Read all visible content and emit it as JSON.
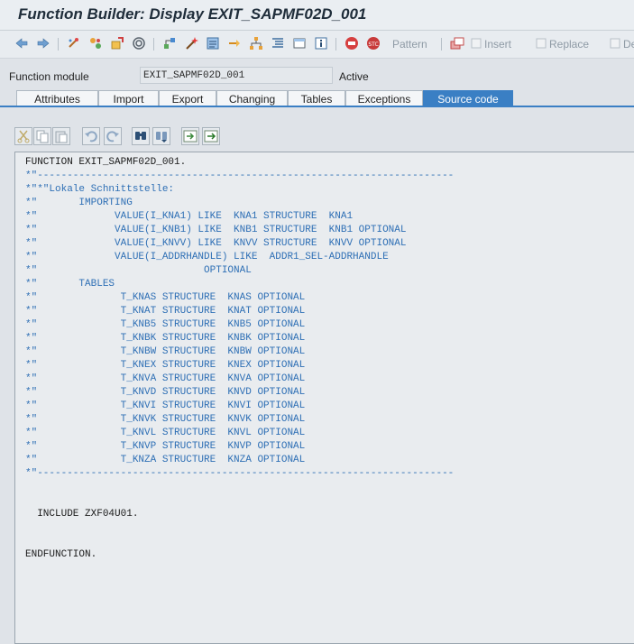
{
  "window": {
    "title": "Function Builder: Display EXIT_SAPMF02D_001"
  },
  "toolbar": {
    "icons": [
      "back-arrow-icon",
      "forward-arrow-icon",
      "other-object-icon",
      "display-change-icon",
      "activate-icon",
      "check-icon",
      "where-used-icon",
      "magic-wand-icon",
      "object-list-icon",
      "navigation-icon",
      "hierarchy-icon",
      "indent-icon",
      "window-icon",
      "info-icon",
      "test-icon",
      "stop-icon"
    ],
    "pattern_label": "Pattern",
    "insert_label": "Insert",
    "replace_label": "Replace",
    "delete_label": "De"
  },
  "function_module": {
    "label": "Function module",
    "value": "EXIT_SAPMF02D_001",
    "status": "Active"
  },
  "tabs": [
    {
      "label": "Attributes",
      "active": false
    },
    {
      "label": "Import",
      "active": false
    },
    {
      "label": "Export",
      "active": false
    },
    {
      "label": "Changing",
      "active": false
    },
    {
      "label": "Tables",
      "active": false
    },
    {
      "label": "Exceptions",
      "active": false
    },
    {
      "label": "Source code",
      "active": true
    }
  ],
  "editor_toolbar": {
    "icons": [
      "cut-icon",
      "copy-icon",
      "paste-icon",
      "undo-icon",
      "redo-icon",
      "find-icon",
      "find-next-icon",
      "insert-block-icon",
      "export-block-icon"
    ]
  },
  "source_code": [
    {
      "text": "FUNCTION EXIT_SAPMF02D_001.",
      "type": "k"
    },
    {
      "text": "*\"----------------------------------------------------------------------",
      "type": "c"
    },
    {
      "text": "*\"*\"Lokale Schnittstelle:",
      "type": "c"
    },
    {
      "text": "*\"       IMPORTING",
      "type": "c"
    },
    {
      "text": "*\"             VALUE(I_KNA1) LIKE  KNA1 STRUCTURE  KNA1",
      "type": "c"
    },
    {
      "text": "*\"             VALUE(I_KNB1) LIKE  KNB1 STRUCTURE  KNB1 OPTIONAL",
      "type": "c"
    },
    {
      "text": "*\"             VALUE(I_KNVV) LIKE  KNVV STRUCTURE  KNVV OPTIONAL",
      "type": "c"
    },
    {
      "text": "*\"             VALUE(I_ADDRHANDLE) LIKE  ADDR1_SEL-ADDRHANDLE",
      "type": "c"
    },
    {
      "text": "*\"                            OPTIONAL",
      "type": "c"
    },
    {
      "text": "*\"       TABLES",
      "type": "c"
    },
    {
      "text": "*\"              T_KNAS STRUCTURE  KNAS OPTIONAL",
      "type": "c"
    },
    {
      "text": "*\"              T_KNAT STRUCTURE  KNAT OPTIONAL",
      "type": "c"
    },
    {
      "text": "*\"              T_KNB5 STRUCTURE  KNB5 OPTIONAL",
      "type": "c"
    },
    {
      "text": "*\"              T_KNBK STRUCTURE  KNBK OPTIONAL",
      "type": "c"
    },
    {
      "text": "*\"              T_KNBW STRUCTURE  KNBW OPTIONAL",
      "type": "c"
    },
    {
      "text": "*\"              T_KNEX STRUCTURE  KNEX OPTIONAL",
      "type": "c"
    },
    {
      "text": "*\"              T_KNVA STRUCTURE  KNVA OPTIONAL",
      "type": "c"
    },
    {
      "text": "*\"              T_KNVD STRUCTURE  KNVD OPTIONAL",
      "type": "c"
    },
    {
      "text": "*\"              T_KNVI STRUCTURE  KNVI OPTIONAL",
      "type": "c"
    },
    {
      "text": "*\"              T_KNVK STRUCTURE  KNVK OPTIONAL",
      "type": "c"
    },
    {
      "text": "*\"              T_KNVL STRUCTURE  KNVL OPTIONAL",
      "type": "c"
    },
    {
      "text": "*\"              T_KNVP STRUCTURE  KNVP OPTIONAL",
      "type": "c"
    },
    {
      "text": "*\"              T_KNZA STRUCTURE  KNZA OPTIONAL",
      "type": "c"
    },
    {
      "text": "*\"----------------------------------------------------------------------",
      "type": "c"
    },
    {
      "text": "",
      "type": "k"
    },
    {
      "text": "",
      "type": "k"
    },
    {
      "text": "  INCLUDE ZXF04U01.",
      "type": "k"
    },
    {
      "text": "",
      "type": "k"
    },
    {
      "text": "",
      "type": "k"
    },
    {
      "text": "ENDFUNCTION.",
      "type": "k"
    }
  ],
  "colors": {
    "accent": "#3a7fc4",
    "comment": "#2e6fb5",
    "code": "#1a1a1a",
    "editor_bg": "#e9ecef"
  }
}
